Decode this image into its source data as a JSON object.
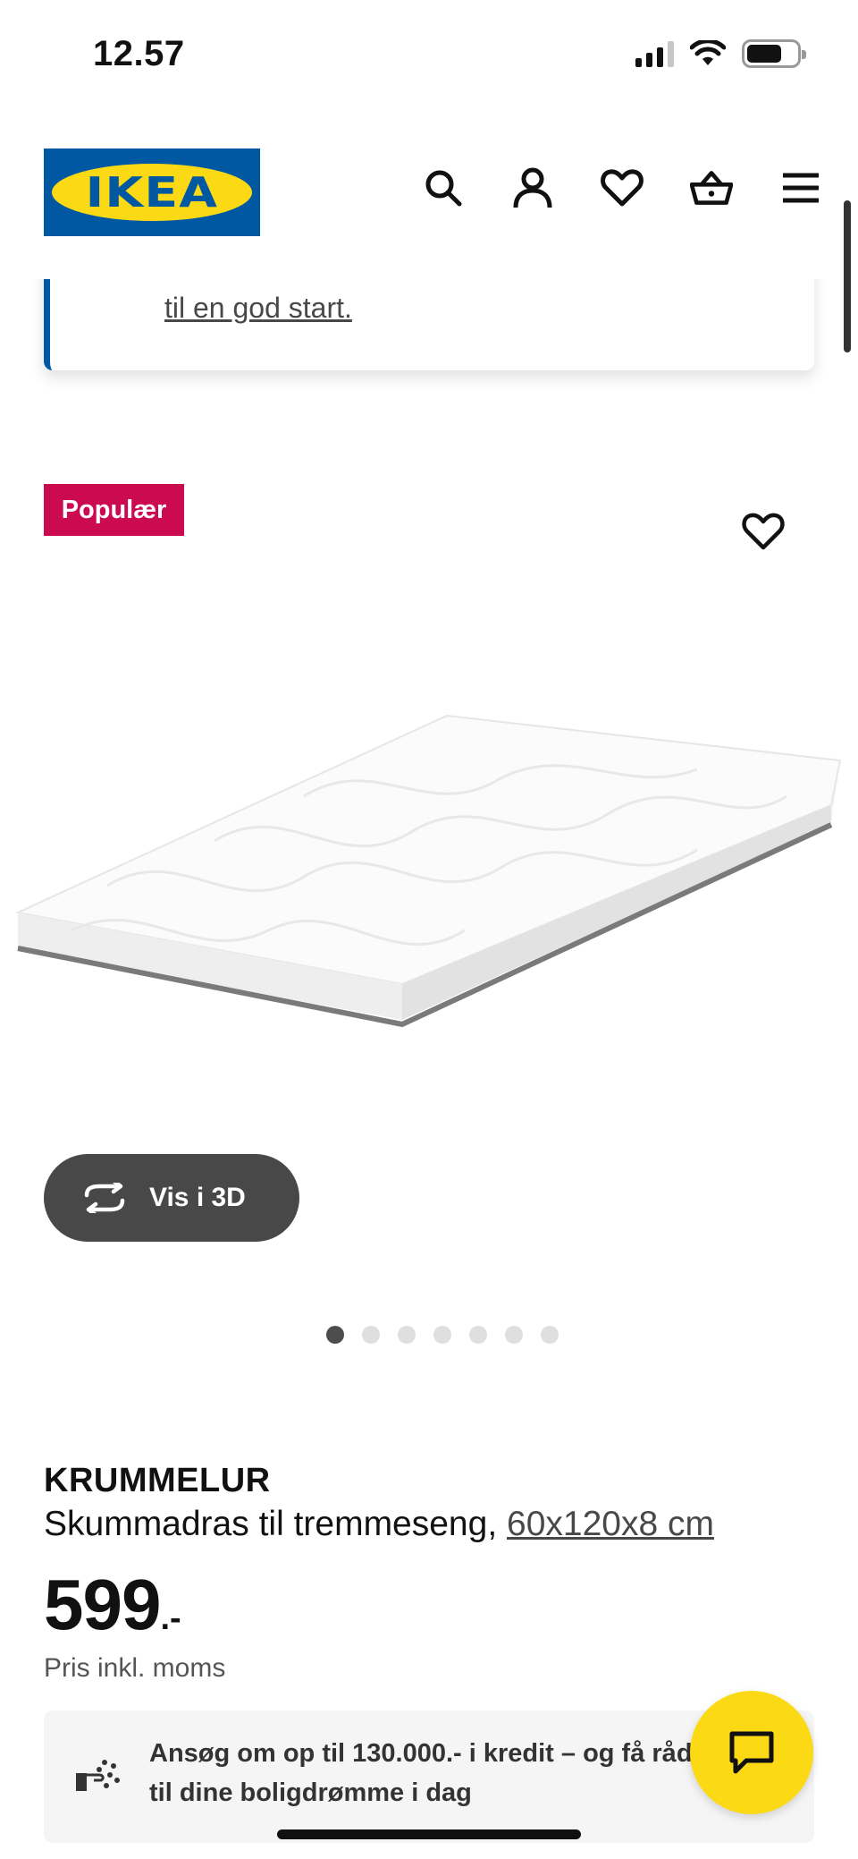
{
  "status_bar": {
    "time": "12.57"
  },
  "header": {
    "logo_text": "IKEA",
    "icons": [
      "search-icon",
      "user-icon",
      "heart-icon",
      "basket-icon",
      "menu-icon"
    ]
  },
  "info_banner": {
    "link_text": "til en god start."
  },
  "product": {
    "badge": "Populær",
    "view_3d_label": "Vis i 3D",
    "image_count": 7,
    "active_image_index": 0,
    "name": "KRUMMELUR",
    "description": "Skummadras til tremmeseng,",
    "size": "60x120x8 cm",
    "price": "599",
    "price_suffix": ".-",
    "price_note": "Pris inkl. moms"
  },
  "credit": {
    "text": "Ansøg om op til 130.000.- i kredit – og få råd til dine boligdrømme i dag"
  },
  "colors": {
    "brand_blue": "#0058a3",
    "brand_yellow": "#fbd914",
    "badge_red": "#cc0a4f",
    "dark_button": "#484848"
  }
}
